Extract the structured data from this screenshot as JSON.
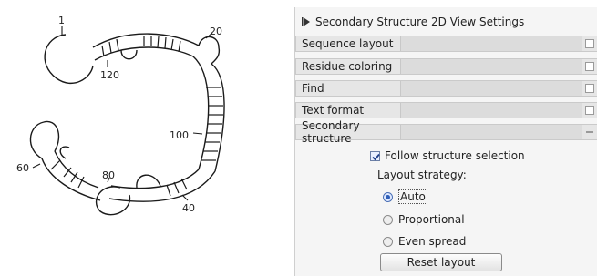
{
  "structure_view": {
    "position_labels": [
      "1",
      "20",
      "120",
      "100",
      "60",
      "80",
      "40"
    ]
  },
  "settings": {
    "title": "Secondary Structure 2D View Settings",
    "sections": [
      {
        "label": "Sequence layout"
      },
      {
        "label": "Residue coloring"
      },
      {
        "label": "Find"
      },
      {
        "label": "Text format"
      },
      {
        "label": "Secondary structure"
      }
    ],
    "follow_structure_selection": {
      "label": "Follow structure selection",
      "checked": true
    },
    "layout_strategy": {
      "label": "Layout strategy:",
      "options": [
        {
          "label": "Auto",
          "selected": true
        },
        {
          "label": "Proportional",
          "selected": false
        },
        {
          "label": "Even spread",
          "selected": false
        }
      ]
    },
    "reset_label": "Reset layout"
  }
}
